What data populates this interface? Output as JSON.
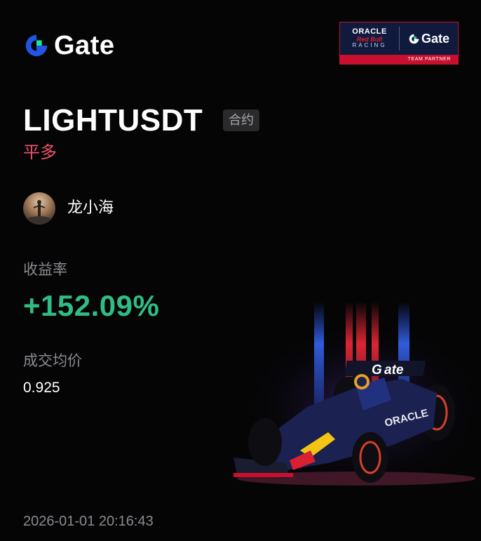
{
  "brand": {
    "name": "Gate",
    "icon": "gate-logo-icon"
  },
  "partner": {
    "oracle": "ORACLE",
    "redbull": "Red Bull",
    "racing": "RACING",
    "gate": "Gate",
    "tag": "TEAM PARTNER"
  },
  "trade": {
    "symbol": "LIGHTUSDT",
    "type_badge": "合约",
    "side": "平多"
  },
  "user": {
    "name": "龙小海",
    "avatar": "avatar"
  },
  "stats": {
    "roi_label": "收益率",
    "roi_value": "+152.09%",
    "price_label": "成交均价",
    "price_value": "0.925"
  },
  "timestamp": "2026-01-01 20:16:43",
  "colors": {
    "background": "#050506",
    "gate_blue": "#2354e6",
    "gate_green": "#17e6a1",
    "profit_green": "#2fbd84",
    "side_red": "#f0536a",
    "muted": "#8b8b90",
    "redbull_red": "#c8102e",
    "redbull_navy": "#0f1a3d"
  }
}
